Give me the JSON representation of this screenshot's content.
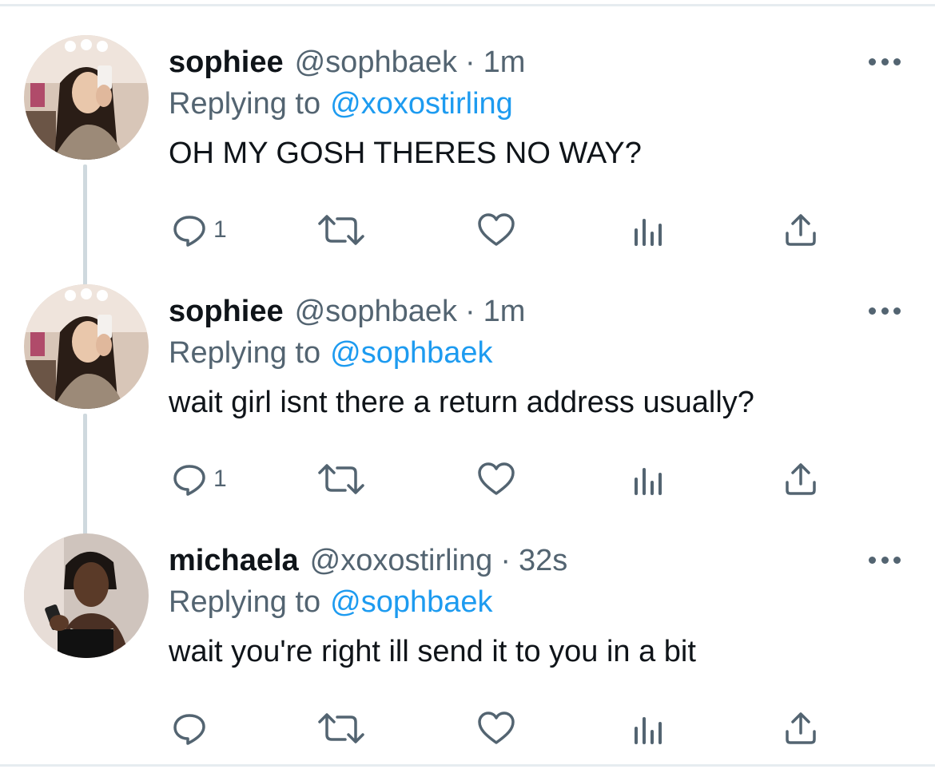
{
  "tweets": [
    {
      "display_name": "sophiee",
      "handle": "@sophbaek",
      "separator": "·",
      "time": "1m",
      "replying_prefix": "Replying to",
      "replying_to": "@xoxostirling",
      "text": "OH MY GOSH THERES NO WAY?",
      "reply_count": "1"
    },
    {
      "display_name": "sophiee",
      "handle": "@sophbaek",
      "separator": "·",
      "time": "1m",
      "replying_prefix": "Replying to",
      "replying_to": "@sophbaek",
      "text": "wait girl isnt there a return address usually?",
      "reply_count": "1"
    },
    {
      "display_name": "michaela",
      "handle": "@xoxostirling",
      "separator": "·",
      "time": "32s",
      "replying_prefix": "Replying to",
      "replying_to": "@sophbaek",
      "text": "wait you're right ill send it to you in a bit",
      "reply_count": ""
    }
  ],
  "icons": {
    "reply": "reply-icon",
    "retweet": "retweet-icon",
    "like": "heart-icon",
    "views": "analytics-icon",
    "share": "share-icon",
    "more": "more-icon"
  },
  "colors": {
    "text": "#0f1419",
    "secondary": "#536471",
    "link": "#1d9bf0",
    "thread_line": "#cfd9de"
  }
}
